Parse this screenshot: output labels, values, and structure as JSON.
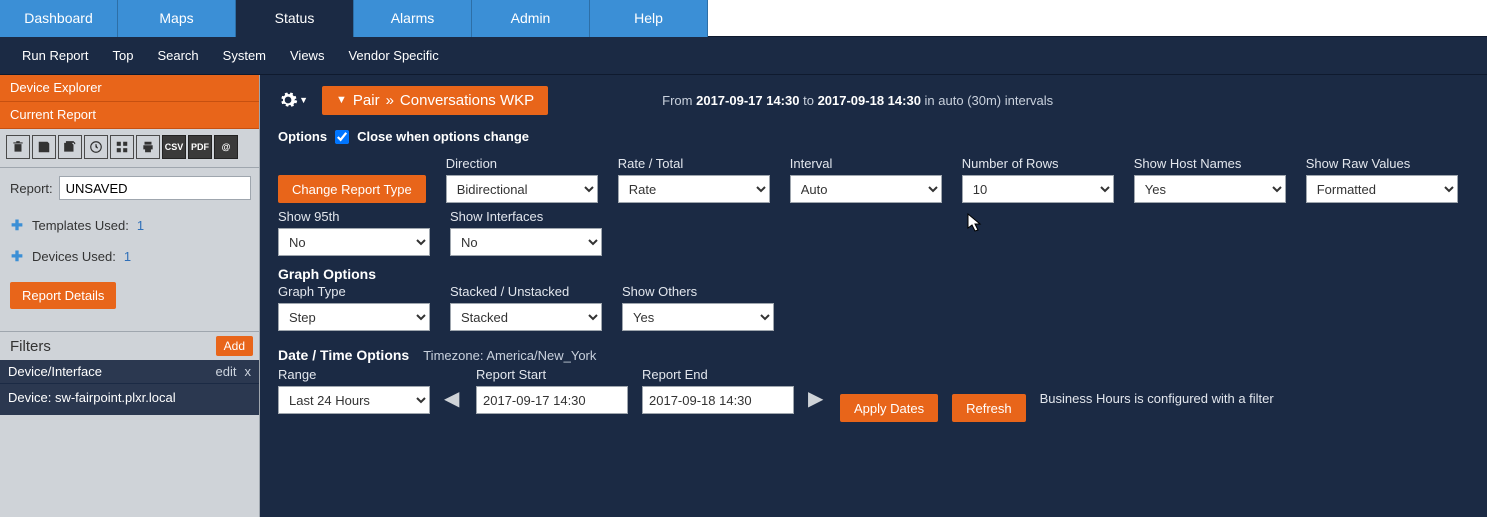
{
  "nav": {
    "tabs": [
      "Dashboard",
      "Maps",
      "Status",
      "Alarms",
      "Admin",
      "Help"
    ],
    "active_index": 2,
    "subnav": [
      "Run Report",
      "Top",
      "Search",
      "System",
      "Views",
      "Vendor Specific"
    ]
  },
  "sidebar": {
    "rows": [
      "Device Explorer",
      "Current Report"
    ],
    "report_label": "Report:",
    "report_value": "UNSAVED",
    "templates_label": "Templates Used:",
    "templates_count": "1",
    "devices_label": "Devices Used:",
    "devices_count": "1",
    "report_details_btn": "Report Details",
    "filters_title": "Filters",
    "add_label": "Add",
    "filter_bar_label": "Device/Interface",
    "filter_bar_edit": "edit",
    "filter_bar_x": "x",
    "device_line": "Device: sw-fairpoint.plxr.local"
  },
  "icons": {
    "trash": "trash-icon",
    "save": "save-icon",
    "saveall": "saveall-icon",
    "clock": "clock-icon",
    "grid": "grid-icon",
    "print": "print-icon",
    "csv": "CSV",
    "pdf": "PDF",
    "at": "@"
  },
  "breadcrumb": {
    "pair": "Pair",
    "sep": "»",
    "report": "Conversations WKP"
  },
  "date_header": {
    "from": "From",
    "start": "2017-09-17 14:30",
    "to": "to",
    "end": "2017-09-18 14:30",
    "tail": "in auto (30m) intervals"
  },
  "options": {
    "title": "Options",
    "close_label": "Close when options change",
    "close_checked": true,
    "change_report_type": "Change Report Type",
    "direction_label": "Direction",
    "direction_value": "Bidirectional",
    "rate_label": "Rate / Total",
    "rate_value": "Rate",
    "interval_label": "Interval",
    "interval_value": "Auto",
    "rows_label": "Number of Rows",
    "rows_value": "10",
    "host_label": "Show Host Names",
    "host_value": "Yes",
    "raw_label": "Show Raw Values",
    "raw_value": "Formatted",
    "s95_label": "Show 95th",
    "s95_value": "No",
    "sif_label": "Show Interfaces",
    "sif_value": "No"
  },
  "graph": {
    "title": "Graph Options",
    "type_label": "Graph Type",
    "type_value": "Step",
    "stack_label": "Stacked / Unstacked",
    "stack_value": "Stacked",
    "others_label": "Show Others",
    "others_value": "Yes"
  },
  "dt": {
    "title": "Date / Time Options",
    "tz_label": "Timezone: America/New_York",
    "range_label": "Range",
    "range_value": "Last 24 Hours",
    "start_label": "Report Start",
    "start_value": "2017-09-17 14:30",
    "end_label": "Report End",
    "end_value": "2017-09-18 14:30",
    "apply": "Apply Dates",
    "refresh": "Refresh",
    "bh": "Business Hours is configured with a filter"
  }
}
